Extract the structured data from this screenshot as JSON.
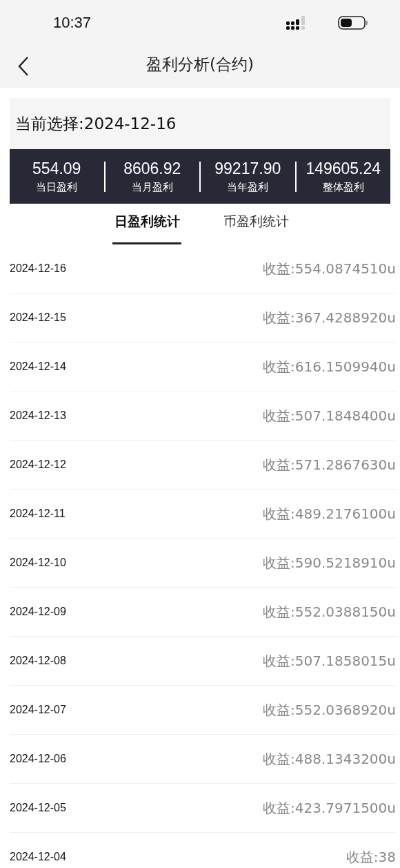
{
  "status_bar": {
    "time": "10:37"
  },
  "nav": {
    "title": "盈利分析(合约)"
  },
  "selection": {
    "label": "当前选择:2024-12-16"
  },
  "stats": [
    {
      "value": "554.09",
      "label": "当日盈利"
    },
    {
      "value": "8606.92",
      "label": "当月盈利"
    },
    {
      "value": "99217.90",
      "label": "当年盈利"
    },
    {
      "value": "149605.24",
      "label": "整体盈利"
    }
  ],
  "tabs": [
    {
      "label": "日盈利统计",
      "selected": true
    },
    {
      "label": "币盈利统计",
      "selected": false
    }
  ],
  "rows": [
    {
      "date": "2024-12-16",
      "income": "收益:554.0874510u"
    },
    {
      "date": "2024-12-15",
      "income": "收益:367.4288920u"
    },
    {
      "date": "2024-12-14",
      "income": "收益:616.1509940u"
    },
    {
      "date": "2024-12-13",
      "income": "收益:507.1848400u"
    },
    {
      "date": "2024-12-12",
      "income": "收益:571.2867630u"
    },
    {
      "date": "2024-12-11",
      "income": "收益:489.2176100u"
    },
    {
      "date": "2024-12-10",
      "income": "收益:590.5218910u"
    },
    {
      "date": "2024-12-09",
      "income": "收益:552.0388150u"
    },
    {
      "date": "2024-12-08",
      "income": "收益:507.1858015u"
    },
    {
      "date": "2024-12-07",
      "income": "收益:552.0368920u"
    },
    {
      "date": "2024-12-06",
      "income": "收益:488.1343200u"
    },
    {
      "date": "2024-12-05",
      "income": "收益:423.7971500u"
    },
    {
      "date": "2024-12-04",
      "income": "收益:38"
    }
  ]
}
